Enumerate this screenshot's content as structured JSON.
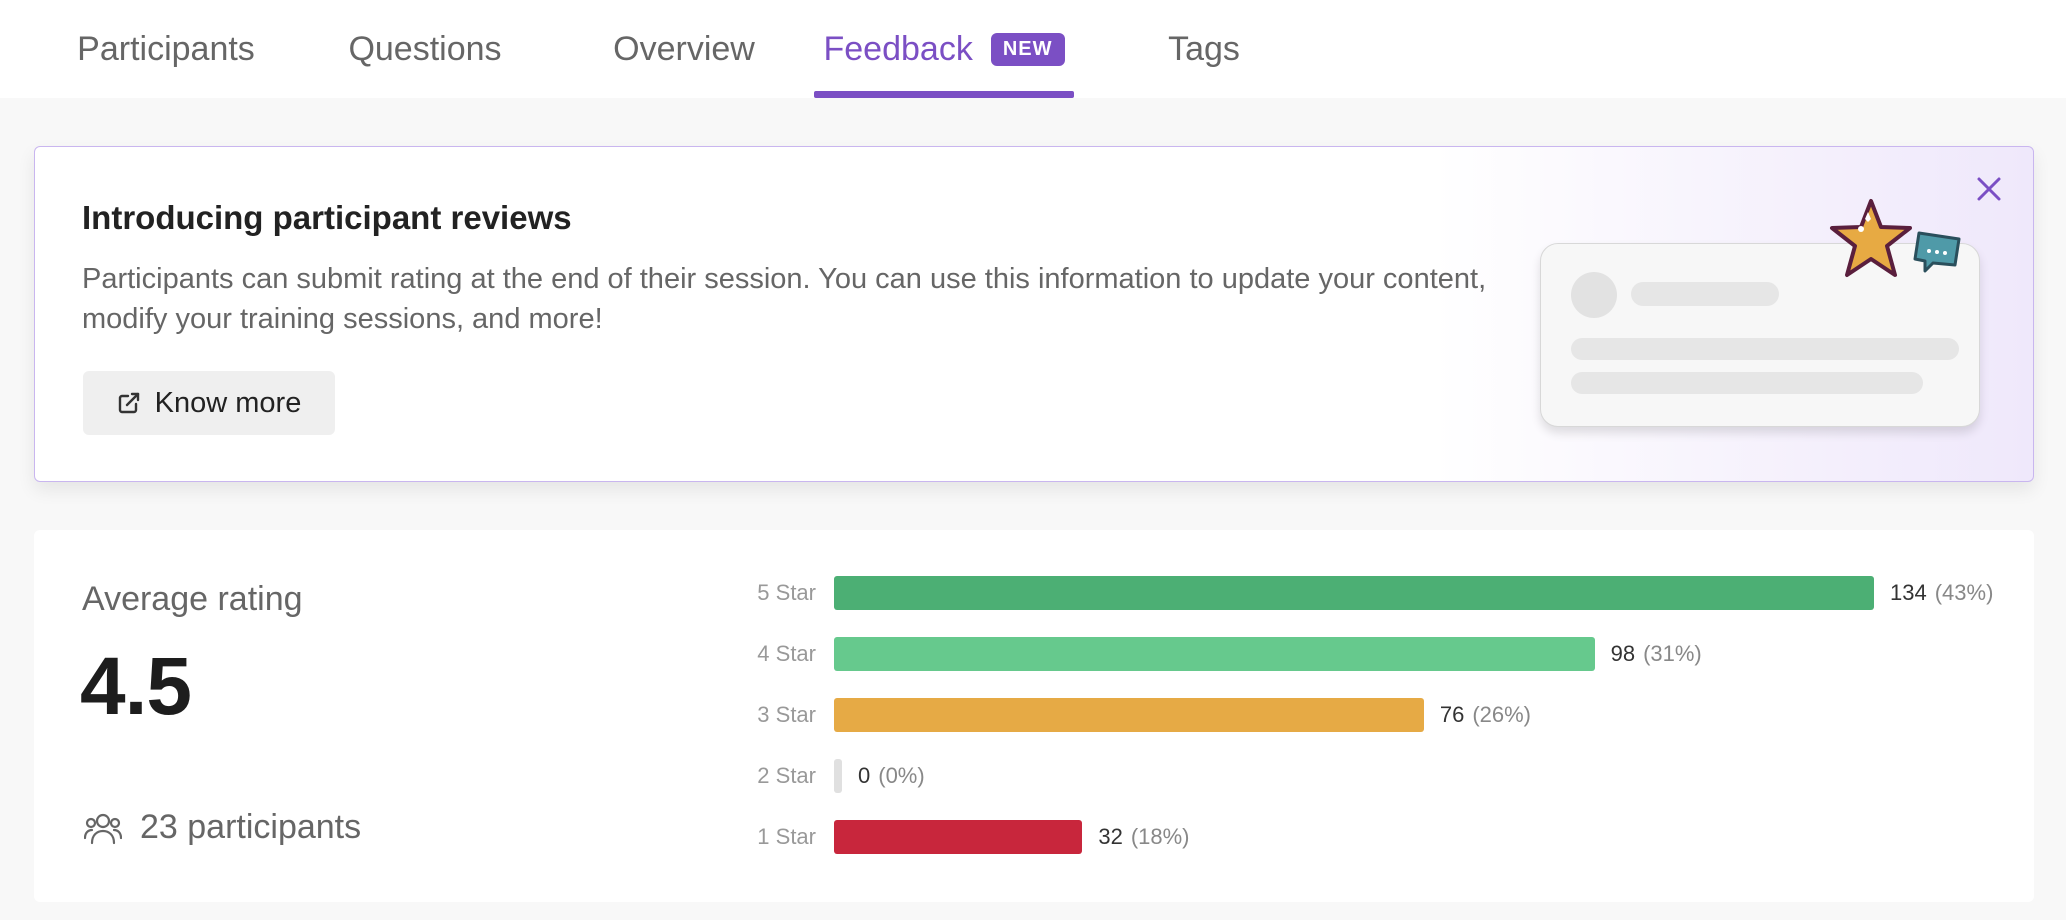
{
  "tabs": [
    {
      "label": "Participants",
      "active": false
    },
    {
      "label": "Questions",
      "active": false
    },
    {
      "label": "Overview",
      "active": false
    },
    {
      "label": "Feedback",
      "active": true,
      "badge": "NEW"
    },
    {
      "label": "Tags",
      "active": false
    }
  ],
  "banner": {
    "title": "Introducing participant reviews",
    "description": "Participants can submit rating at the end of their session. You can use this information to update your content, modify your training sessions, and more!",
    "button_label": "Know more"
  },
  "rating": {
    "label": "Average rating",
    "value": "4.5",
    "participants": "23 participants"
  },
  "chart_data": {
    "type": "bar",
    "orientation": "horizontal",
    "categories": [
      "5 Star",
      "4 Star",
      "3 Star",
      "2 Star",
      "1 Star"
    ],
    "values": [
      134,
      98,
      76,
      0,
      32
    ],
    "labels": [
      "(43%)",
      "(31%)",
      "(26%)",
      "(0%)",
      "(18%)"
    ],
    "colors": [
      "#4caf74",
      "#66c98d",
      "#e6aa45",
      "#e0e0e0",
      "#c8263c"
    ]
  },
  "colors": {
    "accent": "#7b4fc4"
  }
}
